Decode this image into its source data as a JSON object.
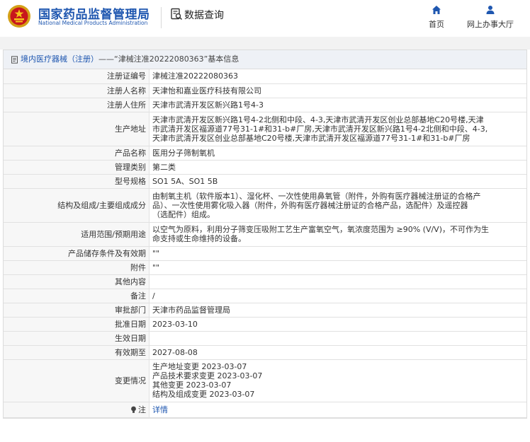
{
  "header": {
    "site_title": "国家药品监督管理局",
    "site_subtitle": "National Medical Products Administration",
    "query_label": "数据查询",
    "nav_home": "首页",
    "nav_hall": "网上办事大厅",
    "brand_color": "#1f57b0"
  },
  "breadcrumb": {
    "link": "境内医疗器械（注册）",
    "title": "——“津械注准20222080363”基本信息"
  },
  "rows": {
    "reg_no": {
      "label": "注册证编号",
      "value": "津械注准20222080363"
    },
    "registrant": {
      "label": "注册人名称",
      "value": "天津怡和嘉业医疗科技有限公司"
    },
    "registrant_addr": {
      "label": "注册人住所",
      "value": "天津市武清开发区新兴路1号4-3"
    },
    "production_addr": {
      "label": "生产地址",
      "lines": [
        "天津市武清开发区新兴路1号4-2北侧和中段、4-3,天津市武清开发区创业总部基地C20号楼,天津",
        "市武清开发区福源道77号31-1#和31-b#厂房,天津市武清开发区新兴路1号4-2北侧和中段、4-3,",
        "天津市武清开发区创业总部基地C20号楼,天津市武清开发区福源道77号31-1#和31-b#厂房"
      ]
    },
    "product_name": {
      "label": "产品名称",
      "value": "医用分子筛制氧机"
    },
    "mgmt_class": {
      "label": "管理类别",
      "value": "第二类"
    },
    "model": {
      "label": "型号规格",
      "value": "SO1 5A、SO1 5B"
    },
    "structure": {
      "label": "结构及组成/主要组成成分",
      "lines": [
        "由制氧主机（软件版本1）、湿化杯、一次性使用鼻氧管（附件，外购有医疗器械注册证的合格产",
        "品）、一次性使用雾化吸入器（附件，外购有医疗器械注册证的合格产品，选配件）及遥控器",
        "（选配件）组成。"
      ]
    },
    "scope": {
      "label": "适用范围/预期用途",
      "lines": [
        "以空气为原料，利用分子筛变压吸附工艺生产富氧空气，氧浓度范围为 ≥90% (V/V)，不可作为生",
        "命支持或生命维持的设备。"
      ]
    },
    "storage": {
      "label": "产品储存条件及有效期",
      "value": "\"\""
    },
    "attachment": {
      "label": "附件",
      "value": "\"\""
    },
    "other": {
      "label": "其他内容",
      "value": ""
    },
    "remark": {
      "label": "备注",
      "value": "/"
    },
    "approval_dept": {
      "label": "审批部门",
      "value": "天津市药品监督管理局"
    },
    "approval_date": {
      "label": "批准日期",
      "value": "2023-03-10"
    },
    "effective_date": {
      "label": "生效日期",
      "value": ""
    },
    "valid_until": {
      "label": "有效期至",
      "value": "2027-08-08"
    },
    "changes": {
      "label": "变更情况",
      "lines": [
        "生产地址变更 2023-03-07",
        "产品技术要求变更 2023-03-07",
        "其他变更 2023-03-07",
        "结构及组成变更 2023-03-07"
      ]
    },
    "note": {
      "label": "注",
      "value": "详情"
    }
  }
}
